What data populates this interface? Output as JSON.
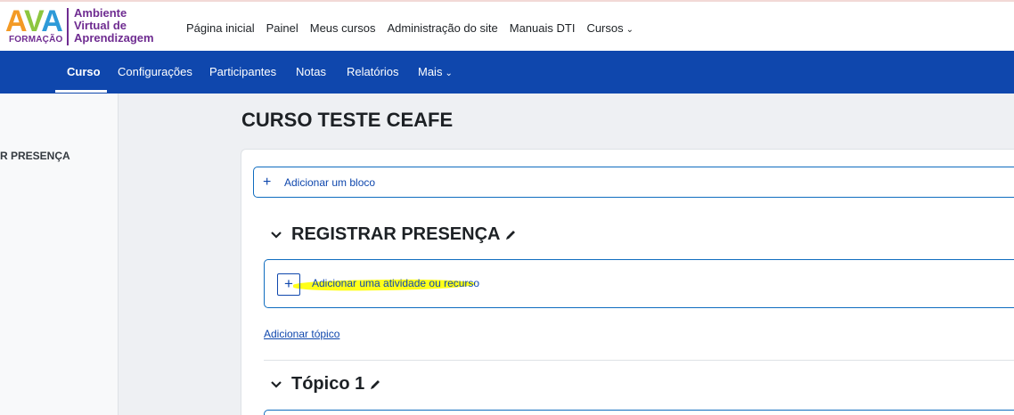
{
  "logo": {
    "brand": "AVA",
    "subtitle": "FORMAÇÃO",
    "text_lines": [
      "Ambiente",
      "Virtual de",
      "Aprendizagem"
    ]
  },
  "topnav": {
    "items": [
      "Página inicial",
      "Painel",
      "Meus cursos",
      "Administração do site",
      "Manuais DTI",
      "Cursos"
    ]
  },
  "secondary_nav": {
    "items": [
      "Curso",
      "Configurações",
      "Participantes",
      "Notas",
      "Relatórios",
      "Mais"
    ],
    "active": "Curso"
  },
  "drawer": {
    "item_label": "R PRESENÇA"
  },
  "page": {
    "title": "CURSO TESTE CEAFE",
    "add_block_label": "Adicionar um bloco"
  },
  "sections": [
    {
      "title": "REGISTRAR PRESENÇA",
      "add_activity_label": "Adicionar uma atividade ou recurso",
      "add_topic_label": "Adicionar tópico"
    },
    {
      "title": "Tópico 1"
    }
  ],
  "colors": {
    "primary_nav": "#0f47ad",
    "link": "#0f47ad",
    "highlight": "#ffff00",
    "logo_purple": "#6f2c91"
  },
  "icons": {
    "add": "plus-icon",
    "collapse": "chevron-down-icon",
    "edit": "pencil-icon",
    "dropdown": "chevron-down-icon"
  }
}
